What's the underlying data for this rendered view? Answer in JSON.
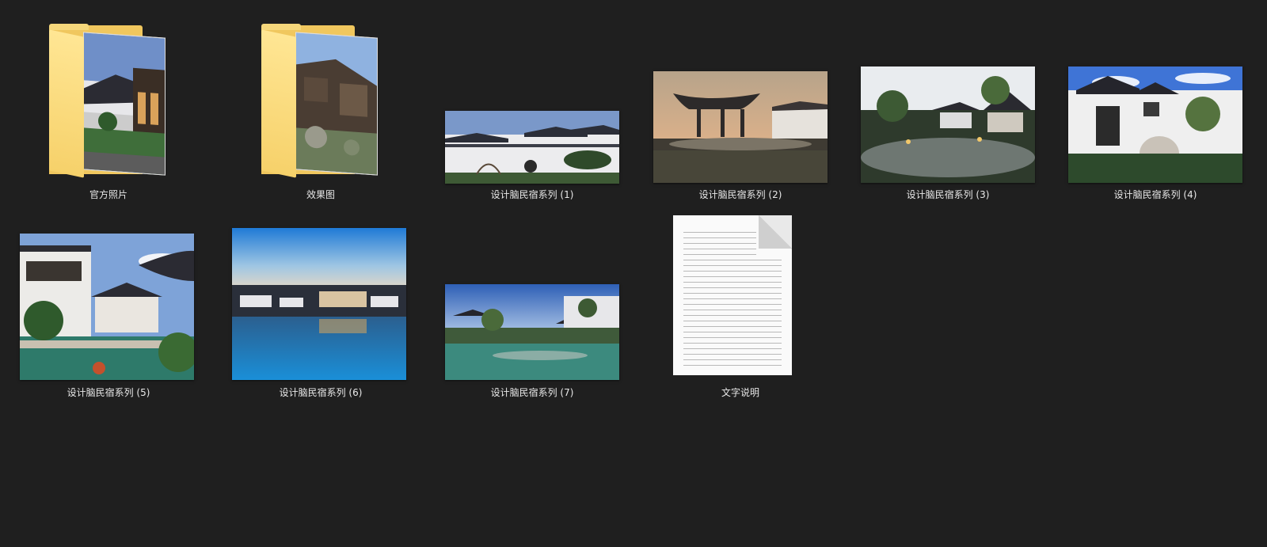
{
  "items": [
    {
      "name": "官方照片",
      "type": "folder"
    },
    {
      "name": "效果图",
      "type": "folder"
    },
    {
      "name": "设计脑民宿系列 (1)",
      "type": "image"
    },
    {
      "name": "设计脑民宿系列 (2)",
      "type": "image"
    },
    {
      "name": "设计脑民宿系列 (3)",
      "type": "image"
    },
    {
      "name": "设计脑民宿系列 (4)",
      "type": "image"
    },
    {
      "name": "设计脑民宿系列 (5)",
      "type": "image"
    },
    {
      "name": "设计脑民宿系列 (6)",
      "type": "image"
    },
    {
      "name": "设计脑民宿系列 (7)",
      "type": "image"
    },
    {
      "name": "文字说明",
      "type": "text-document"
    }
  ],
  "colors": {
    "background": "#1f1f1f",
    "label": "#e8e8e8",
    "folder": "#f6d16a"
  }
}
